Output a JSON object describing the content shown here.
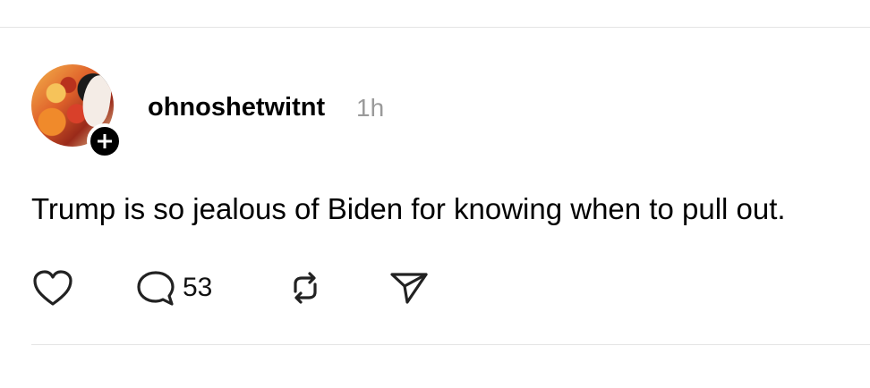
{
  "post": {
    "username": "ohnoshetwitnt",
    "timestamp": "1h",
    "text": "Trump is so jealous of Biden for knowing when to pull out.",
    "reply_count": "53"
  },
  "icons": {
    "like": "heart-icon",
    "reply": "speech-bubble-icon",
    "repost": "repost-arrows-icon",
    "share": "send-icon",
    "follow": "plus-icon"
  }
}
